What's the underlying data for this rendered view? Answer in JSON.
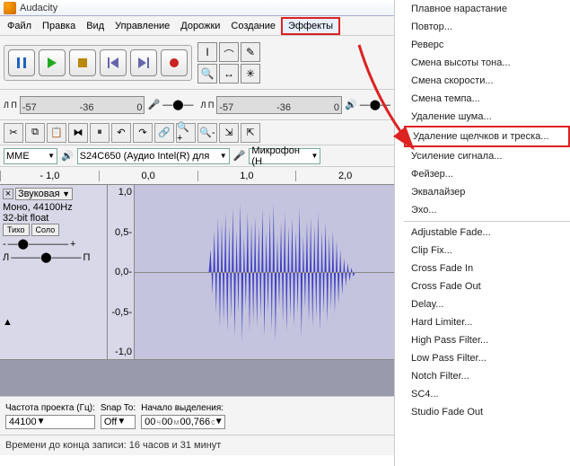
{
  "window": {
    "title": "Audacity"
  },
  "menubar": {
    "items": [
      "Файл",
      "Правка",
      "Вид",
      "Управление",
      "Дорожки",
      "Создание",
      "Эффекты"
    ],
    "selected_index": 6
  },
  "meters": {
    "left": {
      "label": "Л\nП",
      "ticks": [
        "-57",
        "-",
        "-36",
        "-",
        "-",
        "0"
      ]
    },
    "right": {
      "label": "Л\nП",
      "ticks": [
        "-57",
        "-",
        "-36",
        "-",
        "-",
        "0"
      ]
    }
  },
  "devices": {
    "host": "MME",
    "output": "S24C650 (Аудио Intel(R) для",
    "input": "Микрофон (H"
  },
  "ruler": {
    "ticks": [
      "- 1,0",
      "0,0",
      "1,0",
      "2,0"
    ]
  },
  "track": {
    "name": "Звуковая",
    "fmt1": "Моно, 44100Hz",
    "fmt2": "32-bit float",
    "mute": "Тихо",
    "solo": "Соло",
    "vscale": [
      "1,0",
      "0,5-",
      "0,0-",
      "-0,5-",
      "-1,0"
    ]
  },
  "selection": {
    "rate_label": "Частота проекта (Гц):",
    "rate_value": "44100",
    "snap_label": "Snap To:",
    "snap_value": "Off",
    "start_label": "Начало выделения:",
    "time_h": "00",
    "time_m": "00",
    "time_s": "00,766",
    "unit_h": "ч",
    "unit_m": "м",
    "unit_s": "с"
  },
  "status": {
    "text": "Времени до конца записи: 16 часов и 31 минут"
  },
  "effects_menu": {
    "groups": [
      [
        "Плавное нарастание",
        "Повтор...",
        "Реверс",
        "Смена высоты тона...",
        "Смена скорости...",
        "Смена темпа...",
        "Удаление шума...",
        "Удаление щелчков и треска...",
        "Усиление сигнала...",
        "Фейзер...",
        "Эквалайзер",
        "Эхо..."
      ],
      [
        "Adjustable Fade...",
        "Clip Fix...",
        "Cross Fade In",
        "Cross Fade Out",
        "Delay...",
        "Hard Limiter...",
        "High Pass Filter...",
        "Low Pass Filter...",
        "Notch Filter...",
        "SC4...",
        "Studio Fade Out"
      ]
    ],
    "highlight_index": 7
  }
}
